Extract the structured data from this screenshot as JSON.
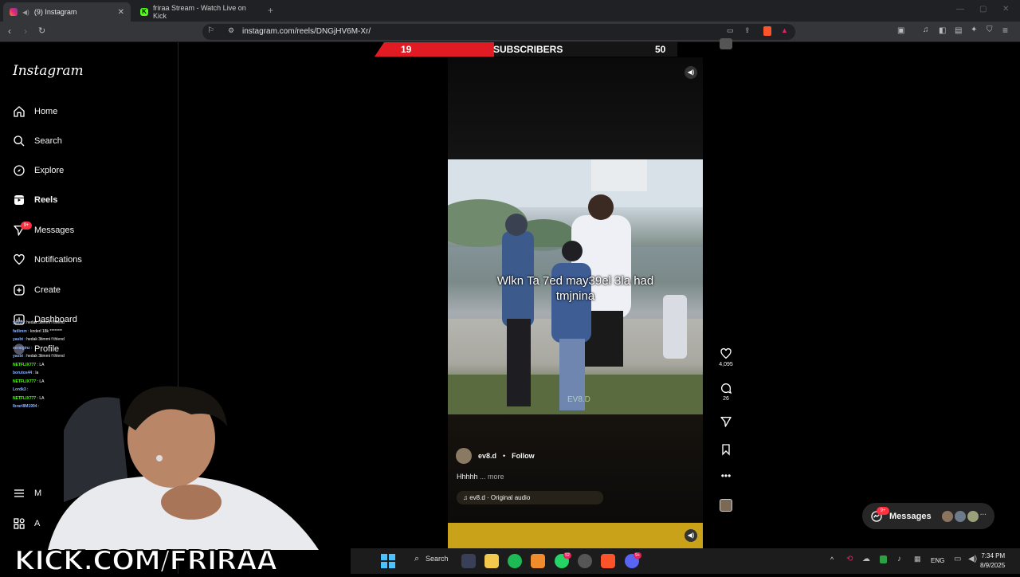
{
  "browser": {
    "tabs": [
      {
        "title": "(9) Instagram",
        "active": true
      },
      {
        "title": "friraa Stream - Watch Live on Kick",
        "active": false
      }
    ],
    "url": "instagram.com/reels/DNGjHV6M-Xr/"
  },
  "sidebar": {
    "logo": "Instagram",
    "items": [
      {
        "label": "Home",
        "icon": "home-icon"
      },
      {
        "label": "Search",
        "icon": "search-icon"
      },
      {
        "label": "Explore",
        "icon": "compass-icon"
      },
      {
        "label": "Reels",
        "icon": "reels-icon"
      },
      {
        "label": "Messages",
        "icon": "send-icon"
      },
      {
        "label": "Notifications",
        "icon": "heart-icon"
      },
      {
        "label": "Create",
        "icon": "plus-icon"
      },
      {
        "label": "Dashboard",
        "icon": "chart-icon"
      },
      {
        "label": "Profile",
        "icon": "avatar-icon"
      },
      {
        "label": "M",
        "icon": "menu-icon"
      },
      {
        "label": "A",
        "icon": "apps-icon"
      }
    ],
    "messages_badge": "9+"
  },
  "stream_overlay": {
    "subscribers_count": "19",
    "subscribers_label": "SUBSCRIBERS",
    "subscribers_goal": "50",
    "kick_url": "KICK.COM/FRIRAA",
    "chat": [
      {
        "user": "yasbt",
        "msg": "hedak 3timmi f thlend"
      },
      {
        "user": "fatlimm",
        "msg": "knderl 18k ********"
      },
      {
        "user": "yasbt",
        "msg": "hedak 3timmi f thlend"
      },
      {
        "user": "seraiginz",
        "msg": ""
      },
      {
        "user": "yasbt",
        "msg": "hedak 3timmi f thlend"
      },
      {
        "user": "NETFLIX777",
        "msg": "LA"
      },
      {
        "user": "borutos44",
        "msg": "la"
      },
      {
        "user": "NETFLIX777",
        "msg": "LA"
      },
      {
        "user": "Lordk3",
        "msg": ""
      },
      {
        "user": "NETFLIX777",
        "msg": "LA"
      },
      {
        "user": "Ibrari8M1994",
        "msg": ""
      }
    ]
  },
  "reel": {
    "caption_overlay": "Wlkn Ta 7ed may39el 3la had tmjnina",
    "watermark": "EV8.D",
    "author": "ev8.d",
    "separator": "•",
    "follow_label": "Follow",
    "caption": "Hhhhh",
    "more_label": "... more",
    "audio": "ev8.d · Original audio",
    "likes": "4,095",
    "comments": "26"
  },
  "messages_pill": {
    "label": "Messages",
    "badge": "9+"
  },
  "taskbar": {
    "search_label": "Search",
    "lang": "ENG",
    "time": "7:34 PM",
    "date": "8/9/2025",
    "whatsapp_badge": "52",
    "discord_badge": "9+"
  },
  "colors": {
    "accent_red": "#e01b24",
    "kick_green": "#53fc18",
    "ig_badge": "#ff3040"
  }
}
